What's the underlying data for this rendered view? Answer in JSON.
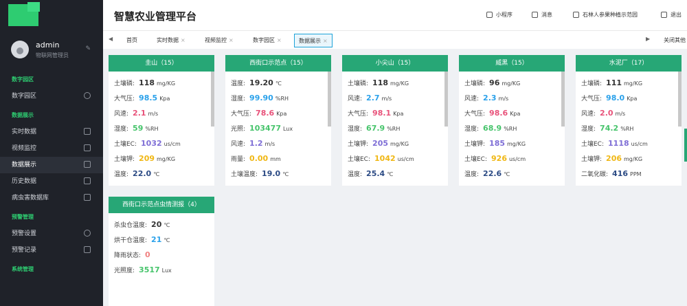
{
  "user": {
    "name": "admin",
    "role": "物联网管理员"
  },
  "nav": {
    "groups": [
      "数字园区",
      "数据展示",
      "预警管理",
      "系统管理"
    ],
    "items": [
      "数字园区",
      "实时数据",
      "视频监控",
      "数据展示",
      "历史数据",
      "病虫害数据库",
      "预警设置",
      "预警记录"
    ]
  },
  "header": {
    "title": "智慧农业管理平台",
    "buttons": [
      "小程序",
      "消息",
      "石林人参果种植示范园",
      "退出"
    ]
  },
  "tabs": {
    "items": [
      {
        "label": "首页",
        "closable": false
      },
      {
        "label": "实时数据",
        "closable": true
      },
      {
        "label": "视频监控",
        "closable": true
      },
      {
        "label": "数字园区",
        "closable": true
      },
      {
        "label": "数据展示",
        "closable": true
      }
    ],
    "close_symbol": "×",
    "left_arrow": "◀",
    "right_arrow": "▶",
    "close_others": "关闭其他"
  },
  "cards": [
    {
      "title": "圭山（15）",
      "rows": [
        {
          "label": "土壤磷:",
          "value": "118",
          "unit": "mg/KG",
          "color": "#333333"
        },
        {
          "label": "大气压:",
          "value": "98.5",
          "unit": "Kpa",
          "color": "#2aa1ea"
        },
        {
          "label": "风速:",
          "value": "2.1",
          "unit": "m/s",
          "color": "#e8527a"
        },
        {
          "label": "湿度:",
          "value": "59",
          "unit": "%RH",
          "color": "#46c46b"
        },
        {
          "label": "土壤EC:",
          "value": "1032",
          "unit": "us/cm",
          "color": "#7e6ed6"
        },
        {
          "label": "土壤钾:",
          "value": "209",
          "unit": "mg/KG",
          "color": "#f0b714"
        },
        {
          "label": "温度:",
          "value": "22.0",
          "unit": "℃",
          "color": "#2b4a84"
        }
      ]
    },
    {
      "title": "西街口示范点（15）",
      "rows": [
        {
          "label": "温度:",
          "value": "19.20",
          "unit": "℃",
          "color": "#333333"
        },
        {
          "label": "湿度:",
          "value": "99.90",
          "unit": "%RH",
          "color": "#2aa1ea"
        },
        {
          "label": "大气压:",
          "value": "78.6",
          "unit": "Kpa",
          "color": "#e8527a"
        },
        {
          "label": "光照:",
          "value": "103477",
          "unit": "Lux",
          "color": "#46c46b"
        },
        {
          "label": "风速:",
          "value": "1.2",
          "unit": "m/s",
          "color": "#7e6ed6"
        },
        {
          "label": "雨量:",
          "value": "0.00",
          "unit": "mm",
          "color": "#f0b714"
        },
        {
          "label": "土壤温度:",
          "value": "19.0",
          "unit": "℃",
          "color": "#2b4a84"
        }
      ]
    },
    {
      "title": "小尖山（15）",
      "rows": [
        {
          "label": "土壤磷:",
          "value": "118",
          "unit": "mg/KG",
          "color": "#333333"
        },
        {
          "label": "风速:",
          "value": "2.7",
          "unit": "m/s",
          "color": "#2aa1ea"
        },
        {
          "label": "大气压:",
          "value": "98.1",
          "unit": "Kpa",
          "color": "#e8527a"
        },
        {
          "label": "湿度:",
          "value": "67.9",
          "unit": "%RH",
          "color": "#46c46b"
        },
        {
          "label": "土壤钾:",
          "value": "205",
          "unit": "mg/KG",
          "color": "#7e6ed6"
        },
        {
          "label": "土壤EC:",
          "value": "1042",
          "unit": "us/cm",
          "color": "#f0b714"
        },
        {
          "label": "温度:",
          "value": "25.4",
          "unit": "℃",
          "color": "#2b4a84"
        }
      ]
    },
    {
      "title": "威黑（15）",
      "rows": [
        {
          "label": "土壤磷:",
          "value": "96",
          "unit": "mg/KG",
          "color": "#333333"
        },
        {
          "label": "风速:",
          "value": "2.3",
          "unit": "m/s",
          "color": "#2aa1ea"
        },
        {
          "label": "大气压:",
          "value": "98.6",
          "unit": "Kpa",
          "color": "#e8527a"
        },
        {
          "label": "湿度:",
          "value": "68.9",
          "unit": "%RH",
          "color": "#46c46b"
        },
        {
          "label": "土壤钾:",
          "value": "185",
          "unit": "mg/KG",
          "color": "#7e6ed6"
        },
        {
          "label": "土壤EC:",
          "value": "926",
          "unit": "us/cm",
          "color": "#f0b714"
        },
        {
          "label": "温度:",
          "value": "22.6",
          "unit": "℃",
          "color": "#2b4a84"
        }
      ]
    },
    {
      "title": "水泥厂（17）",
      "rows": [
        {
          "label": "土壤磷:",
          "value": "111",
          "unit": "mg/KG",
          "color": "#333333"
        },
        {
          "label": "大气压:",
          "value": "98.0",
          "unit": "Kpa",
          "color": "#2aa1ea"
        },
        {
          "label": "风速:",
          "value": "2.0",
          "unit": "m/s",
          "color": "#e8527a"
        },
        {
          "label": "湿度:",
          "value": "74.2",
          "unit": "%RH",
          "color": "#46c46b"
        },
        {
          "label": "土壤EC:",
          "value": "1118",
          "unit": "us/cm",
          "color": "#7e6ed6"
        },
        {
          "label": "土壤钾:",
          "value": "206",
          "unit": "mg/KG",
          "color": "#f0b714"
        },
        {
          "label": "二氧化碳:",
          "value": "416",
          "unit": "PPM",
          "color": "#2b4a84"
        }
      ]
    },
    {
      "title": "西街口示范点虫情测报（4）",
      "rows": [
        {
          "label": "杀虫仓温度:",
          "value": "20",
          "unit": "℃",
          "color": "#333333"
        },
        {
          "label": "烘干仓温度:",
          "value": "21",
          "unit": "℃",
          "color": "#2aa1ea"
        },
        {
          "label": "降雨状态:",
          "value": "0",
          "unit": "",
          "color": "#f08080"
        },
        {
          "label": "光照度:",
          "value": "3517",
          "unit": "Lux",
          "color": "#46c46b"
        }
      ]
    }
  ]
}
